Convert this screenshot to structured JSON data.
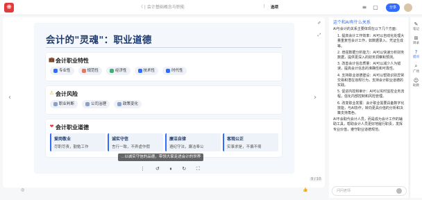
{
  "topbar": {
    "breadcrumb": "〈 | 会计基础概念与职能",
    "sep": "|",
    "title": "选项",
    "share_label": "分享"
  },
  "slide": {
    "title": "会计的\"灵魂\"：职业道德",
    "cards": [
      {
        "title": "会计职业特性",
        "chips": [
          "专业性",
          "规范性",
          "经济性",
          "技术性",
          "时代性"
        ]
      },
      {
        "title": "会计风险",
        "chips": [
          "职业判断",
          "公司治理",
          "政策变化"
        ]
      }
    ],
    "values_card": {
      "title": "会计职业道德",
      "items": [
        {
          "t": "爱岗敬业",
          "d": "尽职尽责，勤勉工作"
        },
        {
          "t": "诚实守信",
          "d": "言行一致，不弄虚作假"
        },
        {
          "t": "廉洁自律",
          "d": "遵纪守法，廉洁奉公"
        },
        {
          "t": "客观公正",
          "d": "实事求是，不偏不倚"
        }
      ]
    }
  },
  "player": {
    "caption": "...以诚实守信的品德，带领大家走进会计的世界",
    "page": "9 / 10"
  },
  "chat": {
    "question": "这个和AI有什么关系",
    "intro": "AI与会计的关系主要体现在以下几个方面：",
    "items": [
      "1. 提高会计工作效率：AI可以自动化处理大量重复性会计工作，如数据录入、凭证生成等。",
      "2. 增强数据分析能力：AI可以快速分析财务数据，提供更深入的财务洞察和预测。",
      "3. 改善会计信息质量：AI可以减少人为错误，提高会计信息的准确性和可靠性。",
      "4. 支持职业道德建设：AI可以帮助识别异常交易和潜在违规行为，支持会计职业道德的实践。",
      "5. 促进内控和审计：AI可以实时监控业务流程，强化内部控制和风险管理。",
      "6. 改变职业发展：会计职业需要具备数字化技能，与AI协作，转向更具价值的分析和决策支持角色。"
    ],
    "outro": "AI不会取代会计人员，而是成为会计工作的辅助工具，帮助会计人员更好地履行职责，发挥专业价值，遵守职业道德规范。",
    "input_placeholder": "问问老师"
  },
  "rail": [
    {
      "icon": "✎",
      "label": "笔记"
    },
    {
      "icon": "⊞",
      "label": "目录"
    },
    {
      "icon": "?",
      "label": "提问"
    },
    {
      "icon": "⌕",
      "label": "广场"
    },
    {
      "icon": "☺",
      "label": "助教"
    }
  ]
}
